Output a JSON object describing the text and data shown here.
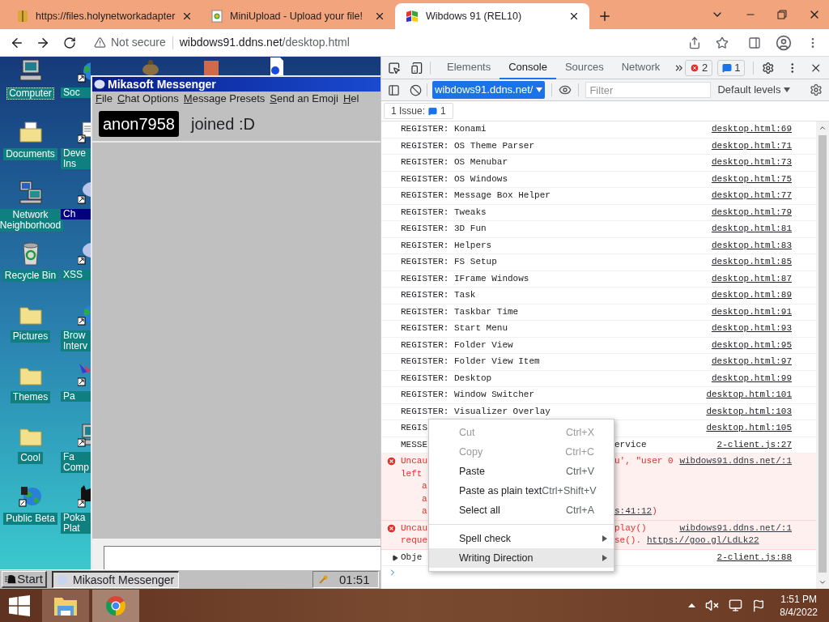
{
  "browser": {
    "tabs": [
      {
        "title": "https://files.holynetworkadapter",
        "selected": false
      },
      {
        "title": "MiniUpload - Upload your file!",
        "selected": false
      },
      {
        "title": "Wibdows 91 (REL10)",
        "selected": true
      }
    ],
    "address": {
      "security": "Not secure",
      "host": "wibdows91.ddns.net",
      "path": "/desktop.html"
    }
  },
  "desktop": {
    "icons": [
      {
        "label": "Computer",
        "kind": "computer",
        "selected": false,
        "focused": true
      },
      {
        "label": "Documents",
        "kind": "documents",
        "selected": false,
        "focused": false
      },
      {
        "label": "Network Neighborhood",
        "kind": "network",
        "selected": false,
        "focused": false
      },
      {
        "label": "Recycle Bin",
        "kind": "recycle",
        "selected": false,
        "focused": false
      },
      {
        "label": "Pictures",
        "kind": "folder",
        "selected": false,
        "focused": false
      },
      {
        "label": "Themes",
        "kind": "folder",
        "selected": false,
        "focused": false
      },
      {
        "label": "Cool",
        "kind": "folder",
        "selected": false,
        "focused": false
      },
      {
        "label": "Public Beta",
        "kind": "globe",
        "selected": false,
        "focused": false
      }
    ],
    "icons_column_2": [
      {
        "label": "Soc",
        "kind": "globe",
        "selected": false
      },
      {
        "label": "Deve Ins",
        "kind": "document",
        "selected": false
      },
      {
        "label": "Ch",
        "kind": "bubble",
        "selected": true
      },
      {
        "label": "XSS",
        "kind": "bubble",
        "selected": false
      },
      {
        "label": "Brow Interv",
        "kind": "globe",
        "selected": false
      },
      {
        "label": "Pa",
        "kind": "bird",
        "selected": false
      },
      {
        "label": "Fa Comp",
        "kind": "computer",
        "selected": false
      },
      {
        "label": "Poka Plat",
        "kind": "cat",
        "selected": false
      }
    ]
  },
  "messenger": {
    "title": "Mikasoft Messenger",
    "menu": [
      "File",
      "Chat Options",
      "Message Presets",
      "Send an Emoji",
      "Hel"
    ],
    "messages": [
      {
        "user": "anon7958",
        "text": "joined :D"
      }
    ]
  },
  "win91_taskbar": {
    "start": "Start",
    "tasks": [
      {
        "label": "Mikasoft Messenger",
        "selected": true
      }
    ],
    "clock": "01:51"
  },
  "devtools": {
    "tabs": [
      {
        "label": "Elements",
        "selected": false
      },
      {
        "label": "Console",
        "selected": true
      },
      {
        "label": "Sources",
        "selected": false
      },
      {
        "label": "Network",
        "selected": false
      }
    ],
    "error_count": "2",
    "message_count": "1",
    "context": "wibdows91.ddns.net/",
    "filter": {
      "placeholder": "Filter"
    },
    "levels": "Default levels",
    "issues": {
      "label": "1 Issue:",
      "count": "1"
    },
    "log": [
      {
        "kind": "log",
        "text": "REGISTER: Konami",
        "source": "desktop.html:69"
      },
      {
        "kind": "log",
        "text": "REGISTER: OS Theme Parser",
        "source": "desktop.html:71"
      },
      {
        "kind": "log",
        "text": "REGISTER: OS Menubar",
        "source": "desktop.html:73"
      },
      {
        "kind": "log",
        "text": "REGISTER: OS Windows",
        "source": "desktop.html:75"
      },
      {
        "kind": "log",
        "text": "REGISTER: Message Box Helper",
        "source": "desktop.html:77"
      },
      {
        "kind": "log",
        "text": "REGISTER: Tweaks",
        "source": "desktop.html:79"
      },
      {
        "kind": "log",
        "text": "REGISTER: 3D Fun",
        "source": "desktop.html:81"
      },
      {
        "kind": "log",
        "text": "REGISTER: Helpers",
        "source": "desktop.html:83"
      },
      {
        "kind": "log",
        "text": "REGISTER: FS Setup",
        "source": "desktop.html:85"
      },
      {
        "kind": "log",
        "text": "REGISTER: IFrame Windows",
        "source": "desktop.html:87"
      },
      {
        "kind": "log",
        "text": "REGISTER: Task",
        "source": "desktop.html:89"
      },
      {
        "kind": "log",
        "text": "REGISTER: Taskbar Time",
        "source": "desktop.html:91"
      },
      {
        "kind": "log",
        "text": "REGISTER: Start Menu",
        "source": "desktop.html:93"
      },
      {
        "kind": "log",
        "text": "REGISTER: Folder View",
        "source": "desktop.html:95"
      },
      {
        "kind": "log",
        "text": "REGISTER: Folder View Item",
        "source": "desktop.html:97"
      },
      {
        "kind": "log",
        "text": "REGISTER: Desktop",
        "source": "desktop.html:99"
      },
      {
        "kind": "log",
        "text": "REGISTER: Window Switcher",
        "source": "desktop.html:101"
      },
      {
        "kind": "log",
        "text": "REGISTER: Visualizer Overlay",
        "source": "desktop.html:103"
      },
      {
        "kind": "log",
        "text": "REGIS",
        "source": "desktop.html:105"
      },
      {
        "kind": "log",
        "text": "MESSE",
        "after": "ervice",
        "source": "2-client.js:27"
      },
      {
        "kind": "error",
        "source": "wibdows91.ddns.net/:1",
        "lines": [
          {
            "text": "Uncau",
            "after": "u', \"user 0"
          },
          {
            "text": "left"
          },
          {
            "text": "a",
            "indent": true
          },
          {
            "text": "a",
            "indent": true
          },
          {
            "text": "a",
            "indent": true,
            "link": "s:41:12",
            "tail": ")"
          }
        ]
      },
      {
        "kind": "error",
        "source": "wibdows91.ddns.net/:1",
        "lines": [
          {
            "text": "Uncau",
            "after": "play()"
          },
          {
            "text": "reque",
            "after": "se().",
            "link": "https://goo.gl/LdLk22"
          }
        ]
      },
      {
        "kind": "object",
        "text": "Obje",
        "source": "2-client.js:88"
      }
    ],
    "context_menu": {
      "groups": [
        [
          {
            "label": "Cut",
            "shortcut": "Ctrl+X",
            "disabled": true,
            "submenu": false,
            "selected": false
          },
          {
            "label": "Copy",
            "shortcut": "Ctrl+C",
            "disabled": true,
            "submenu": false,
            "selected": false
          },
          {
            "label": "Paste",
            "shortcut": "Ctrl+V",
            "disabled": false,
            "submenu": false,
            "selected": false
          },
          {
            "label": "Paste as plain text",
            "shortcut": "Ctrl+Shift+V",
            "disabled": false,
            "submenu": false,
            "selected": false
          },
          {
            "label": "Select all",
            "shortcut": "Ctrl+A",
            "disabled": false,
            "submenu": false,
            "selected": false
          }
        ],
        [
          {
            "label": "Spell check",
            "disabled": false,
            "submenu": true,
            "selected": false
          },
          {
            "label": "Writing Direction",
            "disabled": false,
            "submenu": true,
            "selected": true
          }
        ]
      ]
    }
  },
  "taskbar": {
    "apps": [
      {
        "kind": "explorer",
        "selected": false
      },
      {
        "kind": "chrome",
        "selected": true
      }
    ],
    "time": "1:51 PM",
    "date": "8/4/2022"
  }
}
